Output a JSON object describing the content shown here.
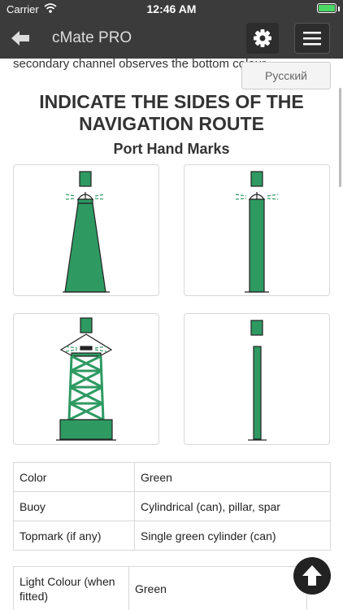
{
  "status": {
    "carrier": "Carrier",
    "time": "12:46 AM"
  },
  "nav": {
    "title": "cMate PRO",
    "back_icon": "arrow-left-icon",
    "settings_icon": "gear-icon",
    "menu_icon": "hamburger-menu-icon"
  },
  "content": {
    "intro_text": "secondary channel observes the bottom colour.",
    "language_button": "Русский",
    "heading_line1": "INDICATE THE SIDES OF THE",
    "heading_line2": "NAVIGATION ROUTE",
    "subheading": "Port Hand Marks",
    "mark_color": "#2e9a62",
    "mark_icons": [
      "conical-tower-mark-icon",
      "pillar-mark-icon",
      "lattice-tower-buoy-icon",
      "spar-mark-icon"
    ]
  },
  "table1": [
    {
      "label": "Color",
      "value": "Green"
    },
    {
      "label": "Buoy",
      "value": "Cylindrical (can), pillar, spar"
    },
    {
      "label": "Topmark (if any)",
      "value": "Single green cylinder (can)"
    }
  ],
  "table2": [
    {
      "label": "Light Colour (when fitted)",
      "value": "Green"
    }
  ],
  "fab_icon": "arrow-up-icon"
}
